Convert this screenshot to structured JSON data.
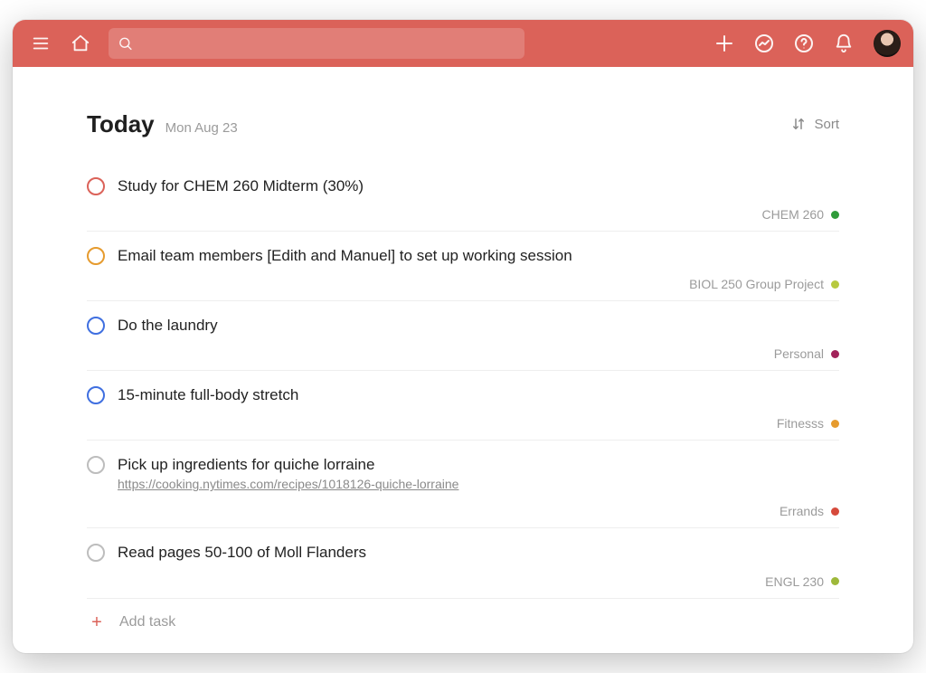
{
  "colors": {
    "accent": "#db6259",
    "priority_red": "#db6259",
    "priority_orange": "#e69b2e",
    "priority_blue": "#3f6fe0",
    "priority_grey": "#bdbdbd"
  },
  "topbar": {
    "search_placeholder": ""
  },
  "header": {
    "title": "Today",
    "date": "Mon Aug 23",
    "sort_label": "Sort"
  },
  "add_task_label": "Add task",
  "tasks": [
    {
      "title": "Study for CHEM 260 Midterm (30%)",
      "checkbox_color": "#db6259",
      "project": {
        "name": "CHEM 260",
        "color": "#2f9b3a"
      }
    },
    {
      "title": "Email team members [Edith and Manuel] to set up working session",
      "checkbox_color": "#e69b2e",
      "project": {
        "name": "BIOL 250 Group Project",
        "color": "#b7c93f"
      }
    },
    {
      "title": "Do the laundry",
      "checkbox_color": "#3f6fe0",
      "project": {
        "name": "Personal",
        "color": "#a2225a"
      }
    },
    {
      "title": "15-minute full-body stretch",
      "checkbox_color": "#3f6fe0",
      "project": {
        "name": "Fitnesss",
        "color": "#e69b2e"
      }
    },
    {
      "title": "Pick up ingredients for quiche lorraine",
      "link": "https://cooking.nytimes.com/recipes/1018126-quiche-lorraine",
      "checkbox_color": "#bdbdbd",
      "project": {
        "name": "Errands",
        "color": "#d64a3b"
      }
    },
    {
      "title": "Read pages 50-100 of Moll Flanders",
      "checkbox_color": "#bdbdbd",
      "project": {
        "name": "ENGL 230",
        "color": "#9eb83a"
      }
    }
  ]
}
